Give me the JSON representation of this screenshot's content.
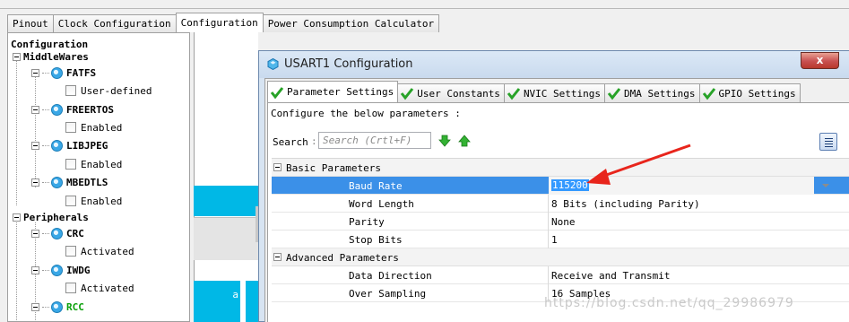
{
  "top_tabs": [
    "Pinout",
    "Clock Configuration",
    "Configuration",
    "Power Consumption Calculator"
  ],
  "tree": {
    "root": "Configuration",
    "middlewares": "MiddleWares",
    "fatfs": "FATFS",
    "fatfs_opt": "User-defined",
    "freertos": "FREERTOS",
    "freertos_opt": "Enabled",
    "libjpeg": "LIBJPEG",
    "libjpeg_opt": "Enabled",
    "mbedtls": "MBEDTLS",
    "mbedtls_opt": "Enabled",
    "peripherals": "Peripherals",
    "crc": "CRC",
    "crc_opt": "Activated",
    "iwdg": "IWDG",
    "iwdg_opt": "Activated",
    "rcc": "RCC"
  },
  "background": {
    "cyan_label": "a"
  },
  "dialog": {
    "title": "USART1 Configuration",
    "close": "x",
    "tabs": [
      "Parameter Settings",
      "User Constants",
      "NVIC Settings",
      "DMA Settings",
      "GPIO Settings"
    ],
    "info": "Configure the below parameters :",
    "search_label": "Search",
    "search_placeholder": "Search (Crtl+F)",
    "basic_group": "Basic Parameters",
    "advanced_group": "Advanced Parameters",
    "rows": {
      "baud_label": "Baud Rate",
      "baud_value": "115200",
      "word_label": "Word Length",
      "word_value": "8 Bits (including Parity)",
      "parity_label": "Parity",
      "parity_value": "None",
      "stop_label": "Stop Bits",
      "stop_value": "1",
      "dir_label": "Data Direction",
      "dir_value": "Receive and Transmit",
      "over_label": "Over Sampling",
      "over_value": "16 Samples"
    }
  },
  "watermark": "https://blog.csdn.net/qq_29986979",
  "colors": {
    "selection": "#3b90e8",
    "accent_cyan": "#00b8e6",
    "active_green": "#0aa00a",
    "annotation_red": "#e8251c"
  }
}
